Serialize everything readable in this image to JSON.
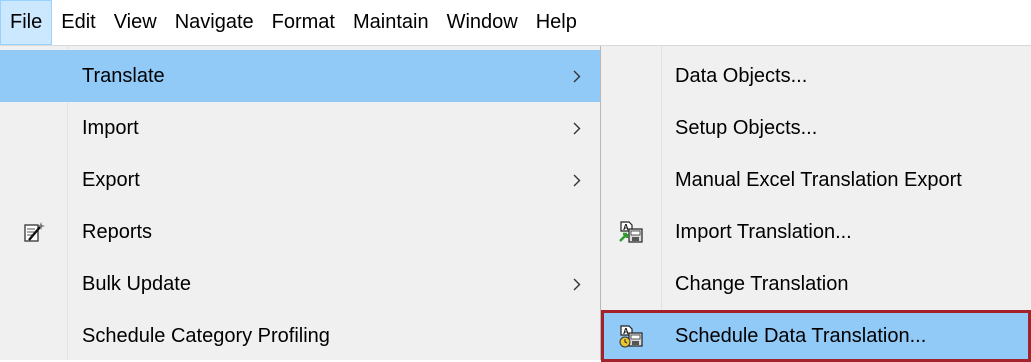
{
  "menubar": {
    "items": [
      {
        "label": "File"
      },
      {
        "label": "Edit"
      },
      {
        "label": "View"
      },
      {
        "label": "Navigate"
      },
      {
        "label": "Format"
      },
      {
        "label": "Maintain"
      },
      {
        "label": "Window"
      },
      {
        "label": "Help"
      }
    ]
  },
  "file_menu": {
    "items": [
      {
        "label": "Translate",
        "has_submenu": true,
        "highlighted": true
      },
      {
        "label": "Import",
        "has_submenu": true
      },
      {
        "label": "Export",
        "has_submenu": true
      },
      {
        "label": "Reports",
        "icon": "report-wizard-icon"
      },
      {
        "label": "Bulk Update",
        "has_submenu": true
      },
      {
        "label": "Schedule Category Profiling"
      }
    ]
  },
  "translate_submenu": {
    "items": [
      {
        "label": "Data Objects..."
      },
      {
        "label": "Setup Objects..."
      },
      {
        "label": "Manual Excel Translation Export"
      },
      {
        "label": "Import Translation...",
        "icon": "import-translation-icon"
      },
      {
        "label": "Change Translation"
      },
      {
        "label": "Schedule Data Translation...",
        "icon": "schedule-translation-icon",
        "selected": true
      }
    ]
  },
  "colors": {
    "highlight": "#91c9f7",
    "menu_background": "#f0f0f0",
    "active_menubar": "#cce8ff",
    "selection_outline": "#a3222b"
  }
}
